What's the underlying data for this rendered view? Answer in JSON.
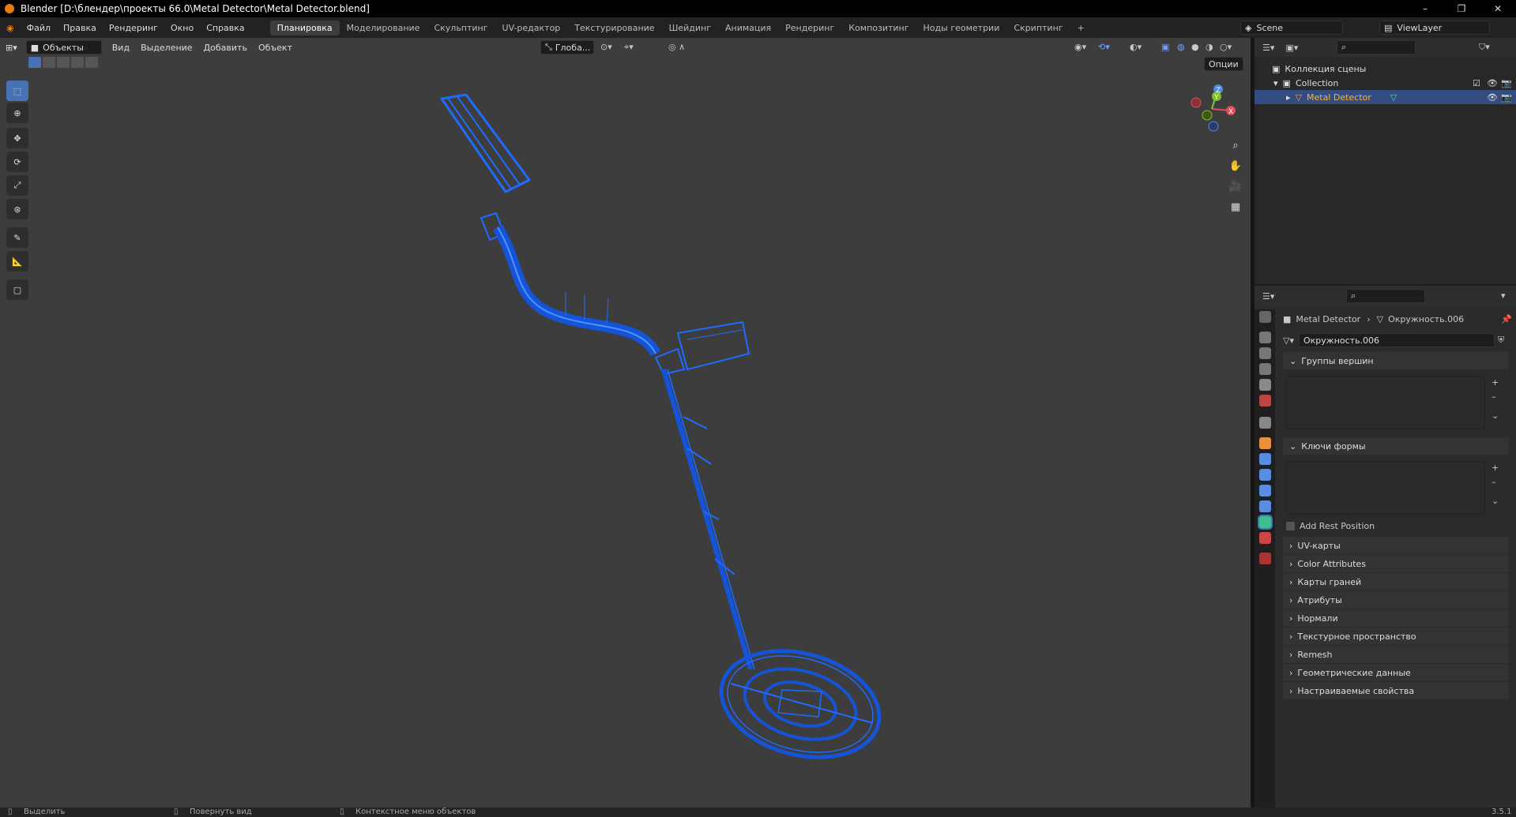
{
  "window": {
    "title": "Blender [D:\\блендер\\проекты 66.0\\Metal Detector\\Metal Detector.blend]",
    "minimize": "–",
    "maximize": "❐",
    "close": "✕"
  },
  "menu": [
    "Файл",
    "Правка",
    "Рендеринг",
    "Окно",
    "Справка"
  ],
  "workspaces": [
    "Планировка",
    "Моделирование",
    "Скульптинг",
    "UV-редактор",
    "Текстурирование",
    "Шейдинг",
    "Анимация",
    "Рендеринг",
    "Композитинг",
    "Ноды геометрии",
    "Скриптинг",
    "+"
  ],
  "active_workspace": 0,
  "scene": {
    "name": "Scene",
    "viewlayer": "ViewLayer"
  },
  "viewport": {
    "mode": "Объекты",
    "menus": [
      "Вид",
      "Выделение",
      "Добавить",
      "Объект"
    ],
    "orientation": "Глоба...",
    "options": "Опции",
    "gizmo": {
      "x": "X",
      "y": "Y",
      "z": "Z"
    },
    "accent_color": "#1e6cff"
  },
  "outliner": {
    "root": "Коллекция сцены",
    "collection": "Collection",
    "object": "Metal Detector"
  },
  "properties": {
    "breadcrumb_object": "Metal Detector",
    "breadcrumb_mesh": "Окружность.006",
    "mesh_name": "Окружность.006",
    "vertex_groups": "Группы вершин",
    "shape_keys": "Ключи формы",
    "add_rest_position": "Add Rest Position",
    "panels": [
      "UV-карты",
      "Color Attributes",
      "Карты граней",
      "Атрибуты",
      "Нормали",
      "Текстурное пространство",
      "Remesh",
      "Геометрические данные",
      "Настраиваемые свойства"
    ]
  },
  "status": {
    "select": "Выделить",
    "rotate": "Повернуть вид",
    "context": "Контекстное меню объектов",
    "version": "3.5.1"
  }
}
